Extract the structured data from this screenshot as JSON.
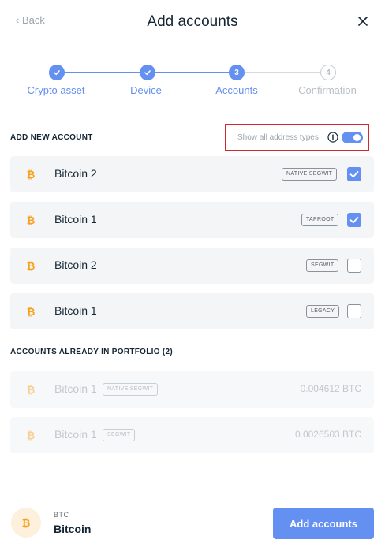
{
  "header": {
    "back_label": "‹ Back",
    "title": "Add accounts"
  },
  "stepper": {
    "steps": [
      {
        "label": "Crypto asset",
        "state": "done",
        "number": ""
      },
      {
        "label": "Device",
        "state": "done",
        "number": ""
      },
      {
        "label": "Accounts",
        "state": "current",
        "number": "3"
      },
      {
        "label": "Confirmation",
        "state": "next",
        "number": "4"
      }
    ]
  },
  "add_new": {
    "title": "ADD NEW ACCOUNT",
    "toggle_label": "Show all address types",
    "toggle_on": true,
    "accounts": [
      {
        "name": "Bitcoin 2",
        "type": "NATIVE SEGWIT",
        "checked": true
      },
      {
        "name": "Bitcoin 1",
        "type": "TAPROOT",
        "checked": true
      },
      {
        "name": "Bitcoin 2",
        "type": "SEGWIT",
        "checked": false
      },
      {
        "name": "Bitcoin 1",
        "type": "LEGACY",
        "checked": false
      }
    ]
  },
  "portfolio": {
    "title": "ACCOUNTS ALREADY IN PORTFOLIO (2)",
    "accounts": [
      {
        "name": "Bitcoin 1",
        "type": "NATIVE SEGWIT",
        "balance": "0.004612 BTC"
      },
      {
        "name": "Bitcoin 1",
        "type": "SEGWIT",
        "balance": "0.0026503 BTC"
      }
    ]
  },
  "footer": {
    "ticker": "BTC",
    "name": "Bitcoin",
    "add_button_label": "Add accounts"
  },
  "colors": {
    "accent": "#6490f1",
    "bitcoin": "#f7a11a",
    "highlight_border": "#d4272f"
  },
  "icons": {
    "close": "close-icon",
    "info": "info-icon",
    "coin": "bitcoin-icon",
    "check": "check-icon"
  }
}
